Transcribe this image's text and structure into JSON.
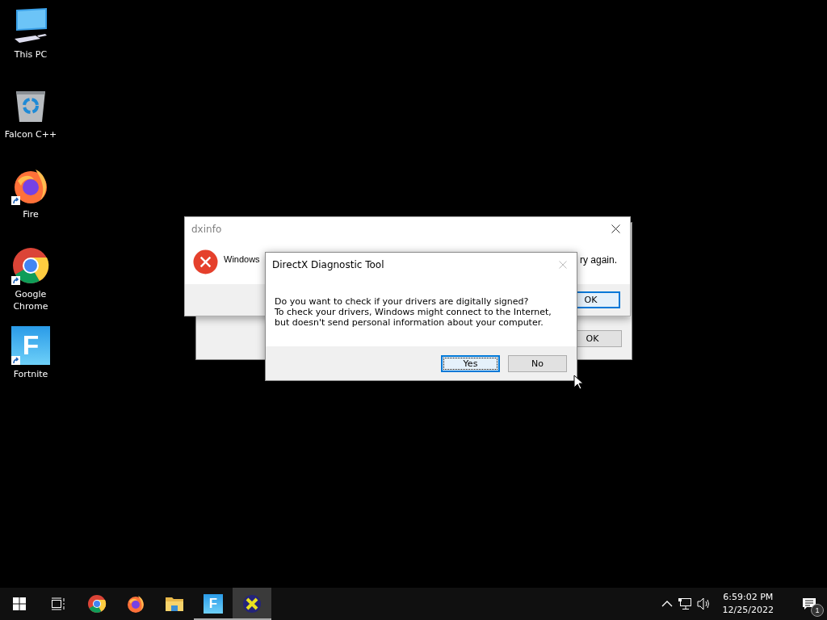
{
  "desktop_icons": [
    {
      "kind": "pc",
      "label": "This PC",
      "shortcut": false
    },
    {
      "kind": "bin",
      "label": "Falcon C++",
      "shortcut": false
    },
    {
      "kind": "firefox",
      "label": "Fire",
      "shortcut": true
    },
    {
      "kind": "chrome",
      "label": "Google Chrome",
      "shortcut": true
    },
    {
      "kind": "fortnite",
      "label": "Fortnite",
      "logo_text": "F",
      "shortcut": true
    }
  ],
  "windows": [
    {
      "kind": "blank",
      "buttons": [
        {
          "label": "OK",
          "default": false
        }
      ]
    },
    {
      "kind": "error",
      "title": "dxinfo",
      "message_start": "Windows",
      "message_end": "ry again.",
      "buttons": [
        {
          "label": "OK",
          "default": true
        }
      ]
    },
    {
      "kind": "question",
      "title": "DirectX Diagnostic Tool",
      "close_disabled": true,
      "message": [
        "Do you want to check if your drivers are digitally signed?",
        "To check your drivers, Windows might connect to the Internet, but doesn't send personal information about your computer."
      ],
      "buttons": [
        {
          "label": "Yes",
          "default": true
        },
        {
          "label": "No",
          "default": false
        }
      ]
    }
  ],
  "taskbar": {
    "items": [
      {
        "kind": "start",
        "running": false,
        "active": false
      },
      {
        "kind": "taskview",
        "running": false,
        "active": false
      },
      {
        "kind": "chrome",
        "running": false,
        "active": false
      },
      {
        "kind": "firefox",
        "running": false,
        "active": false
      },
      {
        "kind": "explorer",
        "running": false,
        "active": false
      },
      {
        "kind": "fortnite",
        "logo_text": "F",
        "running": true,
        "active": false
      },
      {
        "kind": "dx",
        "running": true,
        "active": true
      }
    ],
    "time": "6:59:02 PM",
    "date": "12/25/2022",
    "notification_count": "1"
  }
}
